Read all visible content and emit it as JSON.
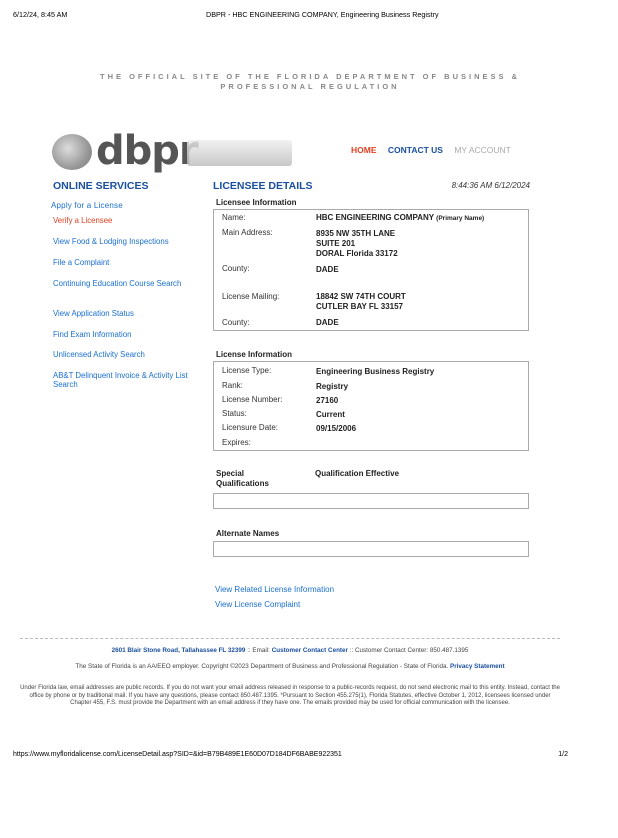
{
  "print_header": {
    "datetime": "6/12/24, 8:45 AM",
    "page_title": "DBPR - HBC ENGINEERING COMPANY, Engineering Business Registry"
  },
  "tagline": "THE OFFICIAL SITE OF THE FLORIDA DEPARTMENT OF BUSINESS & PROFESSIONAL REGULATION",
  "logo_text": "dbpr",
  "topnav": {
    "home": "HOME",
    "contact": "CONTACT US",
    "account": "MY ACCOUNT"
  },
  "sidebar": {
    "title": "ONLINE SERVICES",
    "items": [
      "Apply for a License",
      "Verify a Licensee",
      "View Food & Lodging Inspections",
      "File a Complaint",
      "Continuing Education Course Search",
      "View Application Status",
      "Find Exam Information",
      "Unlicensed Activity Search",
      "AB&T Delinquent Invoice & Activity List Search"
    ]
  },
  "main": {
    "title": "LICENSEE DETAILS",
    "timestamp": "8:44:36 AM 6/12/2024",
    "licensee_section": "Licensee Information",
    "name_label": "Name:",
    "name_value": "HBC ENGINEERING COMPANY",
    "name_suffix": "(Primary Name)",
    "main_address_label": "Main Address:",
    "main_address": [
      "8935 NW 35TH LANE",
      "SUITE 201",
      "DORAL  Florida  33172"
    ],
    "county_label": "County:",
    "county1": "DADE",
    "mailing_label": "License Mailing:",
    "mailing_address": [
      "18842 SW 74TH COURT",
      "CUTLER BAY  FL  33157"
    ],
    "county2": "DADE",
    "license_section": "License Information",
    "license_rows": [
      {
        "label": "License Type:",
        "value": "Engineering Business Registry"
      },
      {
        "label": "Rank:",
        "value": "Registry"
      },
      {
        "label": "License Number:",
        "value": "27160"
      },
      {
        "label": "Status:",
        "value": "Current"
      },
      {
        "label": "Licensure Date:",
        "value": "09/15/2006"
      },
      {
        "label": "Expires:",
        "value": ""
      }
    ],
    "special_qual_label": "Special Qualifications",
    "qual_effective_label": "Qualification Effective",
    "alternate_names": "Alternate Names",
    "related_link": "View Related License Information",
    "complaint_link": "View License Complaint"
  },
  "footer": {
    "address": "2601 Blair Stone Road, Tallahassee FL 32399",
    "email_prefix": ":: Email:",
    "contact_center_link": "Customer Contact Center",
    "contact_center_phone": ":: Customer Contact Center: 850.487.1395",
    "eeo": "The State of Florida is an AA/EEO employer. Copyright ©2023 Department of Business and Professional Regulation - State of Florida.",
    "privacy": "Privacy Statement",
    "legal": "Under Florida law, email addresses are public records. If you do not want your email address released in response to a public-records request, do not send electronic mail to this entity. Instead, contact the office by phone or by traditional mail. If you have any questions, please contact 850.487.1395. *Pursuant to Section 455.275(1), Florida Statutes, effective October 1, 2012, licensees licensed under Chapter 455, F.S. must provide the Department with an email address if they have one. The emails provided may be used for official communication with the licensee."
  },
  "print_footer": {
    "url": "https://www.myfloridalicense.com/LicenseDetail.asp?SID=&id=B79B489E1E60D07D184DF6BABE922351",
    "page": "1/2"
  }
}
